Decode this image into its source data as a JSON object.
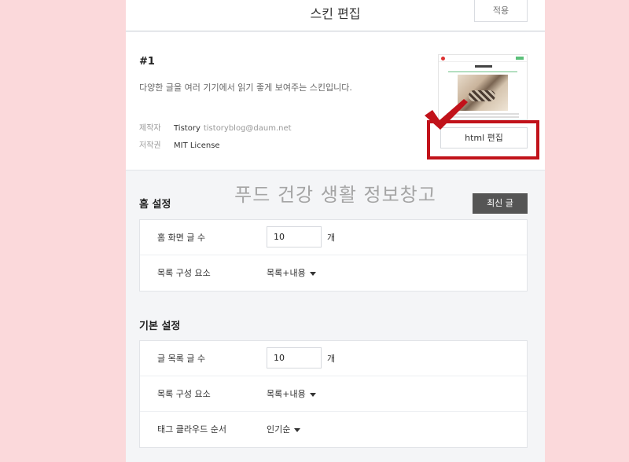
{
  "header": {
    "title": "스킨 편집",
    "apply_label": "적용"
  },
  "skin": {
    "number": "#1",
    "description": "다양한 글을 여러 기기에서 읽기 좋게 보여주는 스킨입니다.",
    "maker_label": "제작자",
    "maker_name": "Tistory",
    "maker_email": "tistoryblog@daum.net",
    "license_label": "저작권",
    "license_value": "MIT License",
    "html_edit_label": "html 편집"
  },
  "watermark": "푸드 건강 생활 정보창고",
  "home_settings": {
    "title": "홈 설정",
    "recent_button": "최신 글",
    "post_count_label": "홈 화면 글 수",
    "post_count_value": "10",
    "unit": "개",
    "list_comp_label": "목록 구성 요소",
    "list_comp_value": "목록+내용"
  },
  "basic_settings": {
    "title": "기본 설정",
    "post_count_label": "글 목록 글 수",
    "post_count_value": "10",
    "unit": "개",
    "list_comp_label": "목록 구성 요소",
    "list_comp_value": "목록+내용",
    "tag_order_label": "태그 클라우드 순서",
    "tag_order_value": "인기순"
  },
  "colors": {
    "callout": "#c1121a",
    "background": "#fbd9db",
    "dark_button": "#555555"
  }
}
